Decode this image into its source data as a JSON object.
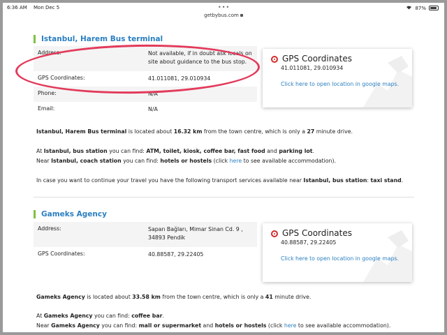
{
  "status": {
    "time": "6:36 AM",
    "date": "Mon Dec 5",
    "battery": "87%",
    "battery_level": 0.87,
    "url": "getbybus.com"
  },
  "sections": [
    {
      "title": "Istanbul, Harem Bus terminal",
      "rows": [
        {
          "label": "Address:",
          "value": "Not available, if in doubt ask locals on site about guidance to the bus stop."
        },
        {
          "label": "GPS Coordinates:",
          "value": "41.011081, 29.010934"
        },
        {
          "label": "Phone:",
          "value": "N/A"
        },
        {
          "label": "Email:",
          "value": "N/A"
        }
      ],
      "gps": {
        "title": "GPS Coordinates",
        "coords": "41.011081, 29.010934",
        "link": "Click here to open location in google maps."
      },
      "desc": {
        "name": "Istanbul, Harem Bus terminal",
        "t1": " is located about ",
        "dist": "16.32 km",
        "t2": " from the town centre, which is only a ",
        "mins": "27",
        "t3": " minute drive."
      },
      "find1": {
        "pre": "At ",
        "place": "Istanbul, bus station",
        "mid": " you can find: ",
        "items": "ATM, toilet, kiosk, coffee bar, fast food",
        "and": " and ",
        "last": "parking lot",
        "end": "."
      },
      "find2": {
        "pre": "Near ",
        "place": "Istanbul, coach station",
        "mid": " you can find: ",
        "items": "hotels or hostels",
        "p1": " (click ",
        "link": "here",
        "p2": " to see available accommodation)."
      },
      "transport": {
        "pre": "In case you want to continue your travel you have the following transport services available near ",
        "place": "Istanbul, bus station",
        "colon": ": ",
        "items": "taxi stand",
        "end": "."
      }
    },
    {
      "title": "Gameks Agency",
      "rows": [
        {
          "label": "Address:",
          "value": "Sapan Bağları, Mimar Sinan Cd. 9 , 34893 Pendik"
        },
        {
          "label": "GPS Coordinates:",
          "value": "40.88587, 29.22405"
        }
      ],
      "gps": {
        "title": "GPS Coordinates",
        "coords": "40.88587, 29.22405",
        "link": "Click here to open location in google maps."
      },
      "desc": {
        "name": "Gameks Agency",
        "t1": " is located about ",
        "dist": "33.58 km",
        "t2": " from the town centre, which is only a ",
        "mins": "41",
        "t3": " minute drive."
      },
      "find1": {
        "pre": "At ",
        "place": "Gameks Agency",
        "mid": " you can find: ",
        "items": "coffee bar",
        "end": "."
      },
      "find2": {
        "pre": "Near ",
        "place": "Gameks Agency",
        "mid": " you can find: ",
        "items": "mall or supermarket",
        "and": " and ",
        "last": "hotels or hostels",
        "p1": " (click ",
        "link": "here",
        "p2": " to see available accommodation)."
      }
    }
  ],
  "colors": {
    "accent_blue": "#2a7fc1",
    "title_bar_green": "#7cc242",
    "annotation_red": "#e33a5a",
    "pin_red": "#d42c2c"
  }
}
